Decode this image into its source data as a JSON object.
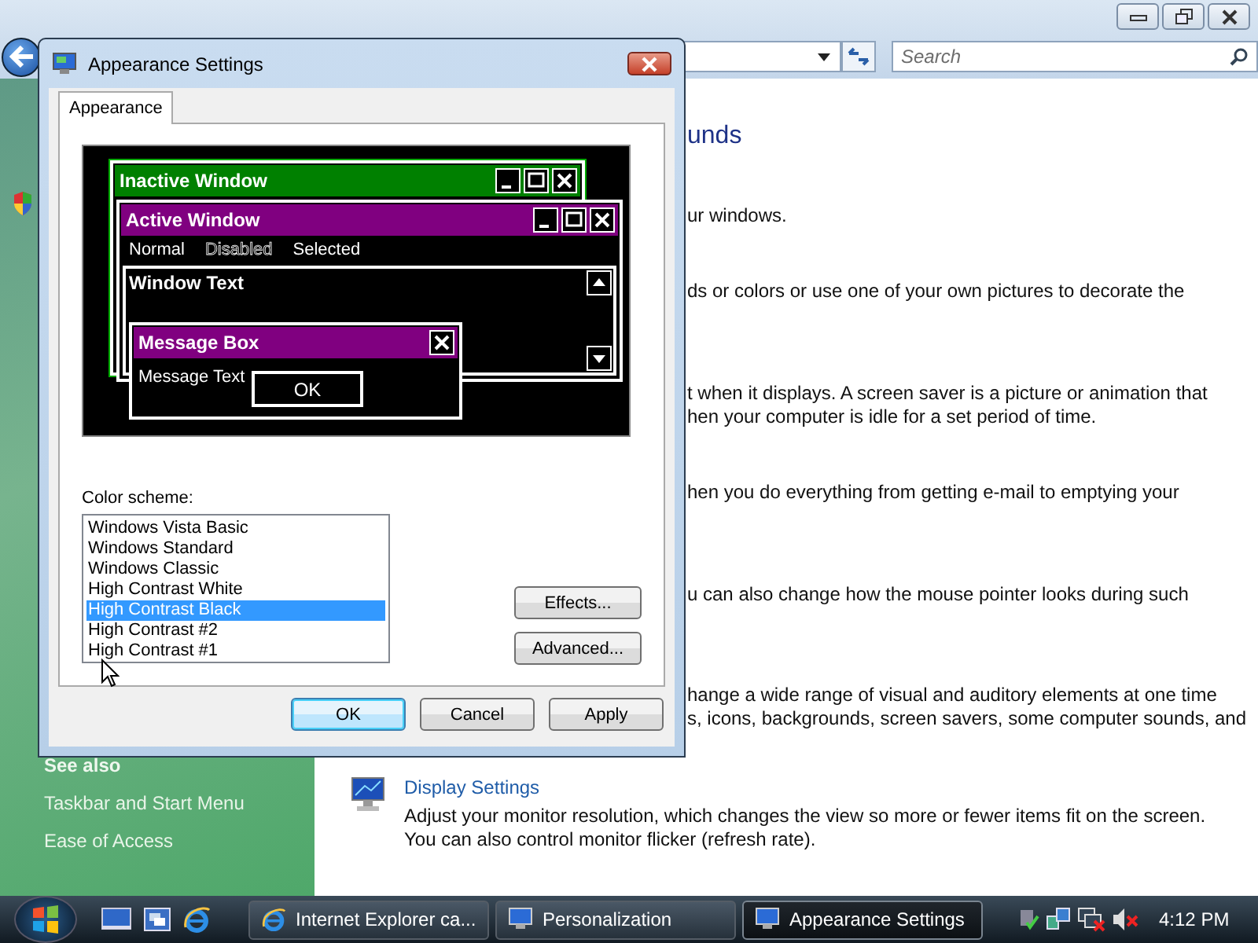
{
  "background_window": {
    "search": {
      "placeholder": "Search"
    },
    "sidebar": {
      "see_also": "See also",
      "links": [
        "Taskbar and Start Menu",
        "Ease of Access"
      ]
    },
    "content_fragments": [
      {
        "kind": "heading",
        "lines": [
          "unds"
        ]
      },
      {
        "kind": "text",
        "lines": [
          "ur windows."
        ]
      },
      {
        "kind": "text",
        "lines": [
          "ds or colors or use one of your own pictures to decorate the"
        ]
      },
      {
        "kind": "text",
        "lines": [
          "t when it displays. A screen saver is a picture or animation that",
          "hen your computer is idle for a set period of time."
        ]
      },
      {
        "kind": "text",
        "lines": [
          "hen you do everything from getting e-mail to emptying your"
        ]
      },
      {
        "kind": "text",
        "lines": [
          "u can also change how the mouse pointer looks during such"
        ]
      },
      {
        "kind": "text",
        "lines": [
          "hange a wide range of visual and auditory elements at one time",
          "s, icons, backgrounds, screen savers, some computer sounds, and"
        ]
      }
    ],
    "display_settings": {
      "title": "Display Settings",
      "description": "Adjust your monitor resolution, which changes the view so more or fewer items fit on the screen. You can also control monitor flicker (refresh rate)."
    }
  },
  "dialog": {
    "title": "Appearance Settings",
    "tabs": [
      {
        "label": "Appearance",
        "selected": true
      }
    ],
    "preview": {
      "inactive_title": "Inactive Window",
      "active_title": "Active Window",
      "menu": [
        {
          "label": "Normal",
          "kind": "normal"
        },
        {
          "label": "Disabled",
          "kind": "disabled"
        },
        {
          "label": "Selected",
          "kind": "selected"
        }
      ],
      "window_text": "Window Text",
      "message_box_title": "Message Box",
      "message_text": "Message Text",
      "ok": "OK"
    },
    "color_scheme": {
      "label": "Color scheme:",
      "options": [
        {
          "label": "Windows Vista Basic",
          "selected": false
        },
        {
          "label": "Windows Standard",
          "selected": false
        },
        {
          "label": "Windows Classic",
          "selected": false
        },
        {
          "label": "High Contrast White",
          "selected": false
        },
        {
          "label": "High Contrast Black",
          "selected": true
        },
        {
          "label": "High Contrast #2",
          "selected": false
        },
        {
          "label": "High Contrast #1",
          "selected": false
        }
      ]
    },
    "side_buttons": [
      "Effects...",
      "Advanced..."
    ],
    "buttons": [
      {
        "label": "OK",
        "default": true
      },
      {
        "label": "Cancel",
        "default": false
      },
      {
        "label": "Apply",
        "default": false
      }
    ]
  },
  "taskbar": {
    "tasks": [
      {
        "label": "Internet Explorer ca...",
        "selected": false
      },
      {
        "label": "Personalization",
        "selected": false
      },
      {
        "label": "Appearance Settings",
        "selected": true
      }
    ],
    "clock": "4:12 PM"
  }
}
